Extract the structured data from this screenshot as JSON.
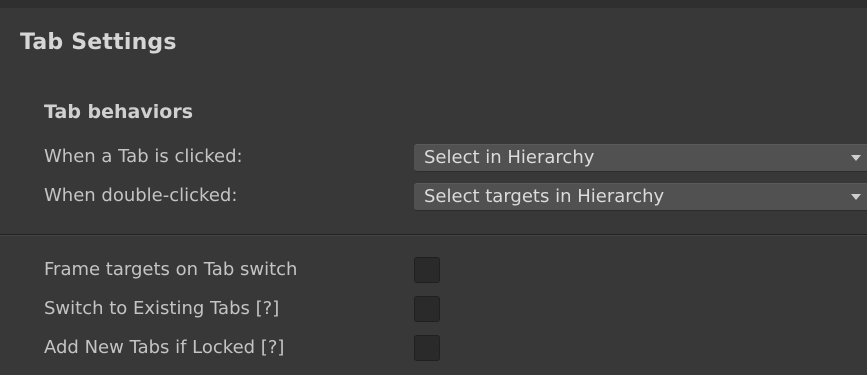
{
  "panel": {
    "title": "Tab Settings"
  },
  "behaviors": {
    "heading": "Tab behaviors",
    "rows": [
      {
        "label": "When a Tab is clicked:",
        "selected": "Select in Hierarchy"
      },
      {
        "label": "When double-clicked:",
        "selected": "Select targets in Hierarchy"
      }
    ]
  },
  "options": [
    {
      "label": "Frame targets on Tab switch",
      "checked": false
    },
    {
      "label": "Switch to Existing Tabs  [?]",
      "checked": false
    },
    {
      "label": "Add New Tabs if Locked  [?]",
      "checked": false
    }
  ],
  "colors": {
    "background": "#383838",
    "dropdown": "#515151",
    "checkbox": "#2a2a2a",
    "text": "#c4c4c4"
  },
  "icons": {
    "dropdown_arrow": "chevron-down-icon"
  }
}
